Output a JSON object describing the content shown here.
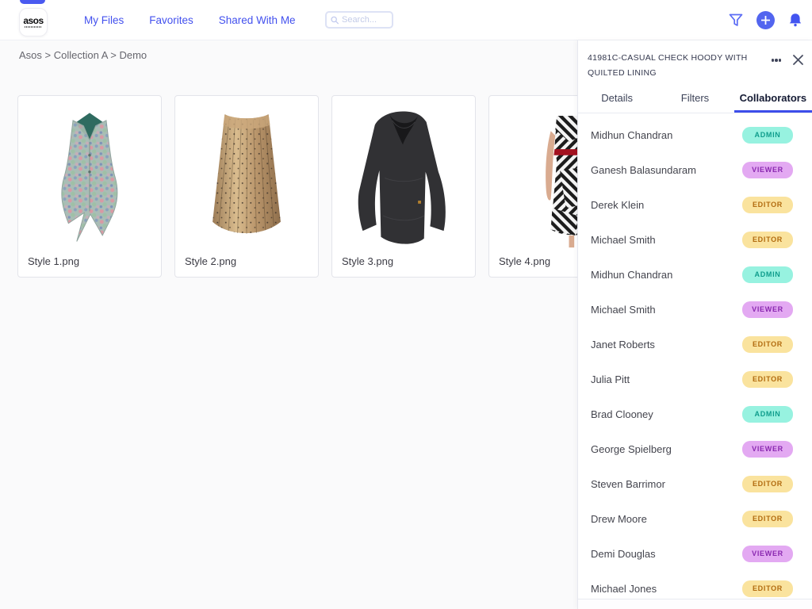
{
  "header": {
    "logo_text": "asos",
    "nav": [
      {
        "label": "My Files"
      },
      {
        "label": "Favorites"
      },
      {
        "label": "Shared With Me"
      }
    ],
    "search_placeholder": "Search..."
  },
  "breadcrumb": "Asos > Collection A > Demo",
  "files": [
    {
      "name": "Style 1.png",
      "image": "floral-vest"
    },
    {
      "name": "Style 2.png",
      "image": "gold-pleated-skirt"
    },
    {
      "name": "Style 3.png",
      "image": "black-sweater"
    },
    {
      "name": "Style 4.png",
      "image": "geometric-dress-red-belt"
    }
  ],
  "panel": {
    "title": "41981C-CASUAL CHECK HOODY WITH QUILTED LINING",
    "tabs": [
      {
        "label": "Details",
        "active": false
      },
      {
        "label": "Filters",
        "active": false
      },
      {
        "label": "Collaborators",
        "active": true
      }
    ],
    "collaborators": [
      {
        "name": "Midhun Chandran",
        "role": "ADMIN"
      },
      {
        "name": "Ganesh Balasundaram",
        "role": "VIEWER"
      },
      {
        "name": "Derek Klein",
        "role": "EDITOR"
      },
      {
        "name": "Michael Smith",
        "role": "EDITOR"
      },
      {
        "name": "Midhun Chandran",
        "role": "ADMIN"
      },
      {
        "name": "Michael Smith",
        "role": "VIEWER"
      },
      {
        "name": "Janet Roberts",
        "role": "EDITOR"
      },
      {
        "name": "Julia Pitt",
        "role": "EDITOR"
      },
      {
        "name": "Brad Clooney",
        "role": "ADMIN"
      },
      {
        "name": "George Spielberg",
        "role": "VIEWER"
      },
      {
        "name": "Steven Barrimor",
        "role": "EDITOR"
      },
      {
        "name": "Drew Moore",
        "role": "EDITOR"
      },
      {
        "name": "Demi Douglas",
        "role": "VIEWER"
      },
      {
        "name": "Michael Jones",
        "role": "EDITOR"
      }
    ],
    "role_colors": {
      "ADMIN": {
        "bg": "#97F2E0",
        "fg": "#0F9D8C"
      },
      "VIEWER": {
        "bg": "#E3A9F2",
        "fg": "#8A28B0"
      },
      "EDITOR": {
        "bg": "#FAE39E",
        "fg": "#B26B0F"
      }
    }
  },
  "colors": {
    "accent": "#4A5AF0",
    "tab_underline": "#3D4EEA"
  }
}
